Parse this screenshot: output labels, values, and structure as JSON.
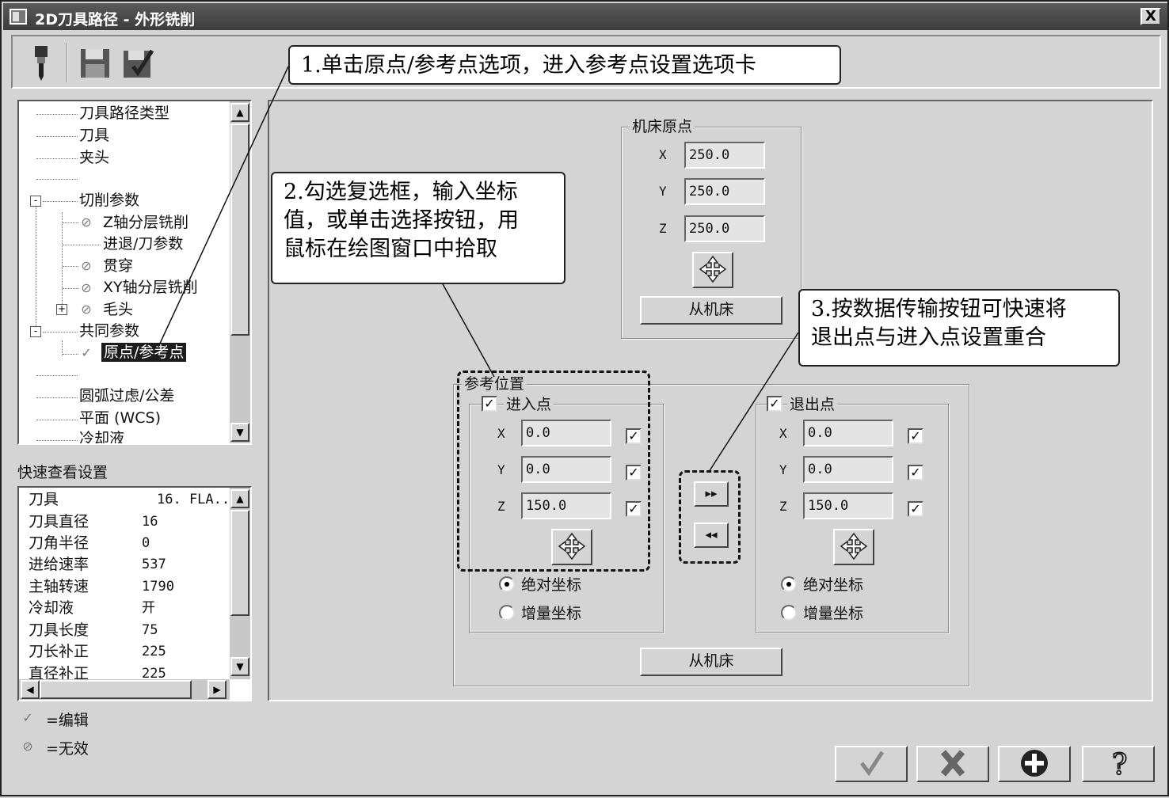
{
  "window": {
    "title": "2D刀具路径 - 外形铣削",
    "close_label": "X"
  },
  "toolbar": {
    "icons": [
      "tool-icon",
      "save-icon",
      "save-as-icon"
    ]
  },
  "tree": {
    "items": [
      {
        "label": "刀具路径类型"
      },
      {
        "label": "刀具"
      },
      {
        "label": "夹头"
      },
      {
        "label": "切削参数",
        "expander": "-"
      },
      {
        "label": "Z轴分层铣削",
        "status": "disabled"
      },
      {
        "label": "进退/刀参数"
      },
      {
        "label": "贯穿",
        "status": "disabled"
      },
      {
        "label": "XY轴分层铣削",
        "status": "disabled"
      },
      {
        "label": "毛头",
        "status": "disabled",
        "expander": "+"
      },
      {
        "label": "共同参数",
        "expander": "-"
      },
      {
        "label": "原点/参考点",
        "status": "edited",
        "selected": true
      },
      {
        "label": "圆弧过虑/公差"
      },
      {
        "label": "平面 (WCS)"
      },
      {
        "label": "冷却液"
      }
    ]
  },
  "quick_view": {
    "title": "快速查看设置",
    "rows": [
      {
        "label": "刀具",
        "value": "16. FLA.."
      },
      {
        "label": "刀具直径",
        "value": "16"
      },
      {
        "label": "刀角半径",
        "value": "0"
      },
      {
        "label": "进给速率",
        "value": "537"
      },
      {
        "label": "主轴转速",
        "value": "1790"
      },
      {
        "label": "冷却液",
        "value": "开"
      },
      {
        "label": "刀具长度",
        "value": "75"
      },
      {
        "label": "刀长补正",
        "value": "225"
      },
      {
        "label": "直径补正",
        "value": "225"
      }
    ]
  },
  "legend": {
    "edited": "=编辑",
    "disabled": "=无效"
  },
  "machine_origin": {
    "title": "机床原点",
    "x_label": "X",
    "x": "250.0",
    "y_label": "Y",
    "y": "250.0",
    "z_label": "Z",
    "z": "250.0",
    "from_machine": "从机床"
  },
  "reference": {
    "title": "参考位置",
    "entry": {
      "title": "进入点",
      "checked": true,
      "x_label": "X",
      "x": "0.0",
      "y_label": "Y",
      "y": "0.0",
      "z_label": "Z",
      "z": "150.0",
      "absolute": "绝对坐标",
      "incremental": "增量坐标",
      "mode": "absolute"
    },
    "exit": {
      "title": "退出点",
      "checked": true,
      "x_label": "X",
      "x": "0.0",
      "y_label": "Y",
      "y": "0.0",
      "z_label": "Z",
      "z": "150.0",
      "absolute": "绝对坐标",
      "incremental": "增量坐标",
      "mode": "absolute"
    },
    "copy_right": "▸▸",
    "copy_left": "◂◂",
    "from_machine": "从机床"
  },
  "callouts": {
    "c1": "1.单击原点/参考点选项，进入参考点设置选项卡",
    "c2_line1": "2.勾选复选框，输入坐标",
    "c2_line2": "值，或单击选择按钮，用",
    "c2_line3": "鼠标在绘图窗口中拾取",
    "c3_line1": "3.按数据传输按钮可快速将",
    "c3_line2": "退出点与进入点设置重合"
  },
  "footer": {
    "icons": [
      "ok-check-icon",
      "cancel-x-icon",
      "add-plus-icon",
      "help-question-icon"
    ]
  },
  "checkmark": "✓"
}
